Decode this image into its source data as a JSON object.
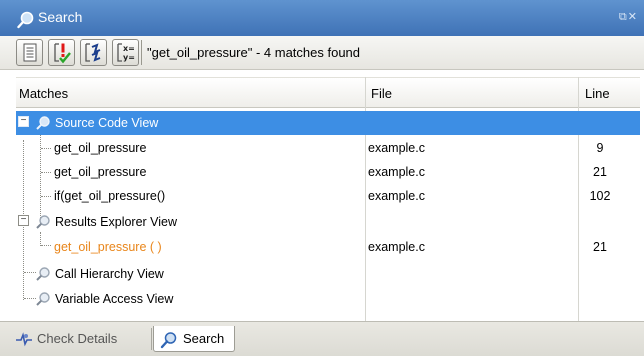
{
  "window": {
    "title": "Search",
    "controls": "⧉✕"
  },
  "toolbar": {
    "buttons": [
      {
        "name": "document-icon"
      },
      {
        "name": "error-check-icon"
      },
      {
        "name": "expand-branches-icon"
      },
      {
        "name": "variable-xy-icon"
      }
    ],
    "status": "\"get_oil_pressure\" - 4 matches found"
  },
  "table": {
    "headers": {
      "matches": "Matches",
      "file": "File",
      "line": "Line"
    },
    "rows": [
      {
        "label": "Source Code View",
        "file": "",
        "line": "",
        "selected": true
      },
      {
        "label": "get_oil_pressure",
        "file": "example.c",
        "line": "9"
      },
      {
        "label": "get_oil_pressure",
        "file": "example.c",
        "line": "21"
      },
      {
        "label": "if(get_oil_pressure()",
        "file": "example.c",
        "line": "102"
      },
      {
        "label": "Results Explorer View",
        "file": "",
        "line": ""
      },
      {
        "label": "get_oil_pressure ( )",
        "file": "example.c",
        "line": "21",
        "highlight": "#e9861b"
      },
      {
        "label": "Call Hierarchy View",
        "file": "",
        "line": ""
      },
      {
        "label": "Variable Access View",
        "file": "",
        "line": ""
      }
    ]
  },
  "tabs": [
    {
      "label": "Check Details",
      "active": false
    },
    {
      "label": "Search",
      "active": true
    }
  ],
  "colors": {
    "selection": "#3d8ee4",
    "titlebar": "#4a7fc1",
    "highlight_text": "#e9861b"
  }
}
